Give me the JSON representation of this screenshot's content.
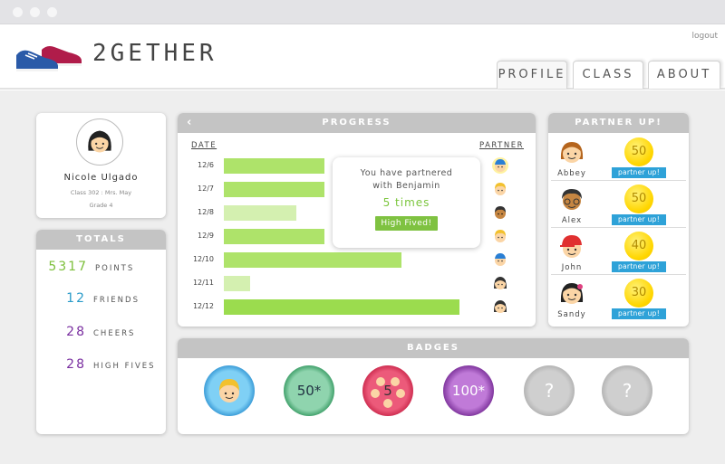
{
  "app": {
    "brand": "2GETHER",
    "logout": "logout"
  },
  "nav": {
    "tabs": [
      {
        "label": "PROFILE",
        "active": true
      },
      {
        "label": "CLASS"
      },
      {
        "label": "ABOUT"
      }
    ]
  },
  "profile": {
    "name": "Nicole Ulgado",
    "class": "Class 302 : Mrs. May",
    "grade": "Grade 4"
  },
  "totals": {
    "title": "TOTALS",
    "items": [
      {
        "value": "5317",
        "label": "POINTS",
        "color": "#7cbf3a"
      },
      {
        "value": "12",
        "label": "FRIENDS",
        "color": "#2a9bc9"
      },
      {
        "value": "28",
        "label": "CHEERS",
        "color": "#7a2fa0"
      },
      {
        "value": "28",
        "label": "HIGH FIVES",
        "color": "#7a2fa0"
      }
    ]
  },
  "progress": {
    "title": "PROGRESS",
    "back_icon": "chevron-left-icon",
    "date_header": "DATE",
    "partner_header": "PARTNER",
    "rows": [
      {
        "date": "12/6",
        "fraction": 0.42,
        "shade": "mid",
        "partner": "john"
      },
      {
        "date": "12/7",
        "fraction": 0.42,
        "shade": "mid",
        "partner": "abbey"
      },
      {
        "date": "12/8",
        "fraction": 0.3,
        "shade": "light",
        "partner": "alex"
      },
      {
        "date": "12/9",
        "fraction": 0.42,
        "shade": "mid",
        "partner": "abbey"
      },
      {
        "date": "12/10",
        "fraction": 0.74,
        "shade": "mid",
        "partner": "john"
      },
      {
        "date": "12/11",
        "fraction": 0.11,
        "shade": "light",
        "partner": "sandy"
      },
      {
        "date": "12/12",
        "fraction": 0.98,
        "shade": "dark",
        "partner": "sandy"
      }
    ],
    "tooltip": {
      "line1": "You have partnered",
      "line2": "with Benjamin",
      "times": "5 times",
      "button": "High Fived!"
    }
  },
  "partners": {
    "title": "PARTNER UP!",
    "items": [
      {
        "name": "Abbey",
        "points": "50",
        "button": "partner up!"
      },
      {
        "name": "Alex",
        "points": "50",
        "button": "partner up!"
      },
      {
        "name": "John",
        "points": "40",
        "button": "partner up!"
      },
      {
        "name": "Sandy",
        "points": "30",
        "button": "partner up!"
      }
    ]
  },
  "badges": {
    "title": "BADGES",
    "items": [
      {
        "kind": "face",
        "label": ""
      },
      {
        "kind": "green",
        "label": "50*"
      },
      {
        "kind": "red",
        "label": "5"
      },
      {
        "kind": "purple",
        "label": "100*"
      },
      {
        "kind": "locked",
        "label": "?"
      },
      {
        "kind": "locked",
        "label": "?"
      }
    ]
  },
  "colors": {
    "bar_dark": "#9bdc4e",
    "bar_mid": "#aee36a",
    "bar_light": "#d4f0b0",
    "header_gray": "#c4c4c4",
    "coin": "#ffd600",
    "partner_btn": "#2ea2d8"
  }
}
